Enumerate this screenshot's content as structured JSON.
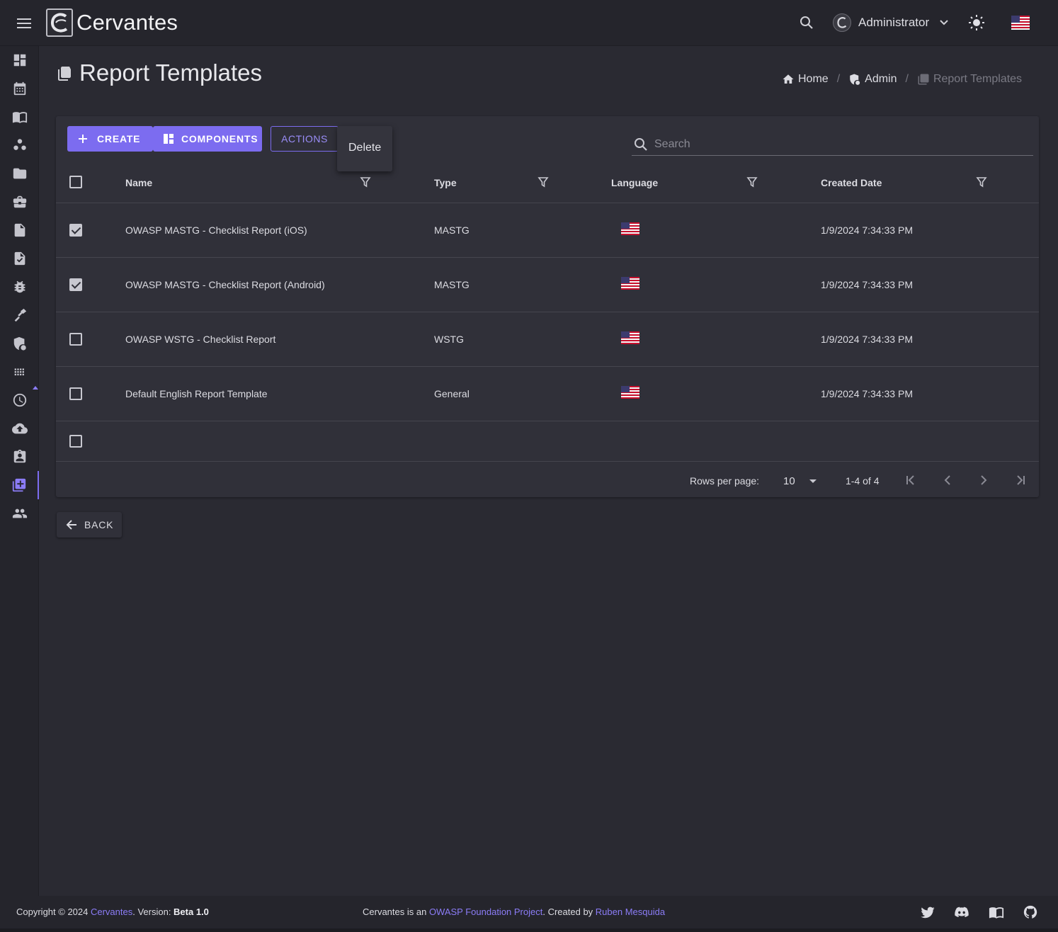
{
  "app": {
    "title": "Cervantes"
  },
  "header": {
    "user_name": "Administrator"
  },
  "page": {
    "title": "Report Templates"
  },
  "breadcrumb": {
    "home": "Home",
    "admin": "Admin",
    "current": "Report Templates"
  },
  "toolbar": {
    "create_label": "CREATE",
    "components_label": "COMPONENTS",
    "actions_label": "ACTIONS",
    "search_placeholder": "Search"
  },
  "menu": {
    "delete_label": "Delete"
  },
  "table": {
    "columns": {
      "name": "Name",
      "type": "Type",
      "language": "Language",
      "created": "Created Date"
    },
    "rows": [
      {
        "checked": true,
        "name": "OWASP MASTG - Checklist Report (iOS)",
        "type": "MASTG",
        "language": "en-US",
        "created": "1/9/2024 7:34:33 PM"
      },
      {
        "checked": true,
        "name": "OWASP MASTG - Checklist Report (Android)",
        "type": "MASTG",
        "language": "en-US",
        "created": "1/9/2024 7:34:33 PM"
      },
      {
        "checked": false,
        "name": "OWASP WSTG - Checklist Report",
        "type": "WSTG",
        "language": "en-US",
        "created": "1/9/2024 7:34:33 PM"
      },
      {
        "checked": false,
        "name": "Default English Report Template",
        "type": "General",
        "language": "en-US",
        "created": "1/9/2024 7:34:33 PM"
      }
    ]
  },
  "pager": {
    "rows_per_page_label": "Rows per page:",
    "rows_per_page": "10",
    "range": "1-4 of 4"
  },
  "back": {
    "label": "BACK"
  },
  "footer": {
    "copyright_prefix": "Copyright © 2024 ",
    "brand": "Cervantes",
    "version_prefix": ". Version: ",
    "version": "Beta 1.0",
    "mid_prefix": "Cervantes is an ",
    "owasp_link": "OWASP Foundation Project",
    "created_by": ". Created by ",
    "author": "Ruben Mesquida"
  },
  "colors": {
    "accent": "#7c6cf0",
    "background": "#2a2a32",
    "surface": "#303039",
    "bar": "#25252c"
  },
  "icons": {
    "sidebar": [
      "dashboard-icon",
      "calendar-icon",
      "book-icon",
      "customers-icon",
      "folder-icon",
      "briefcase-icon",
      "document-icon",
      "task-icon",
      "bug-icon",
      "targets-icon",
      "admin-shield-icon",
      "grid-icon",
      "clock-icon",
      "cloud-upload-icon",
      "contact-badge-icon",
      "report-templates-icon",
      "users-icon"
    ]
  }
}
